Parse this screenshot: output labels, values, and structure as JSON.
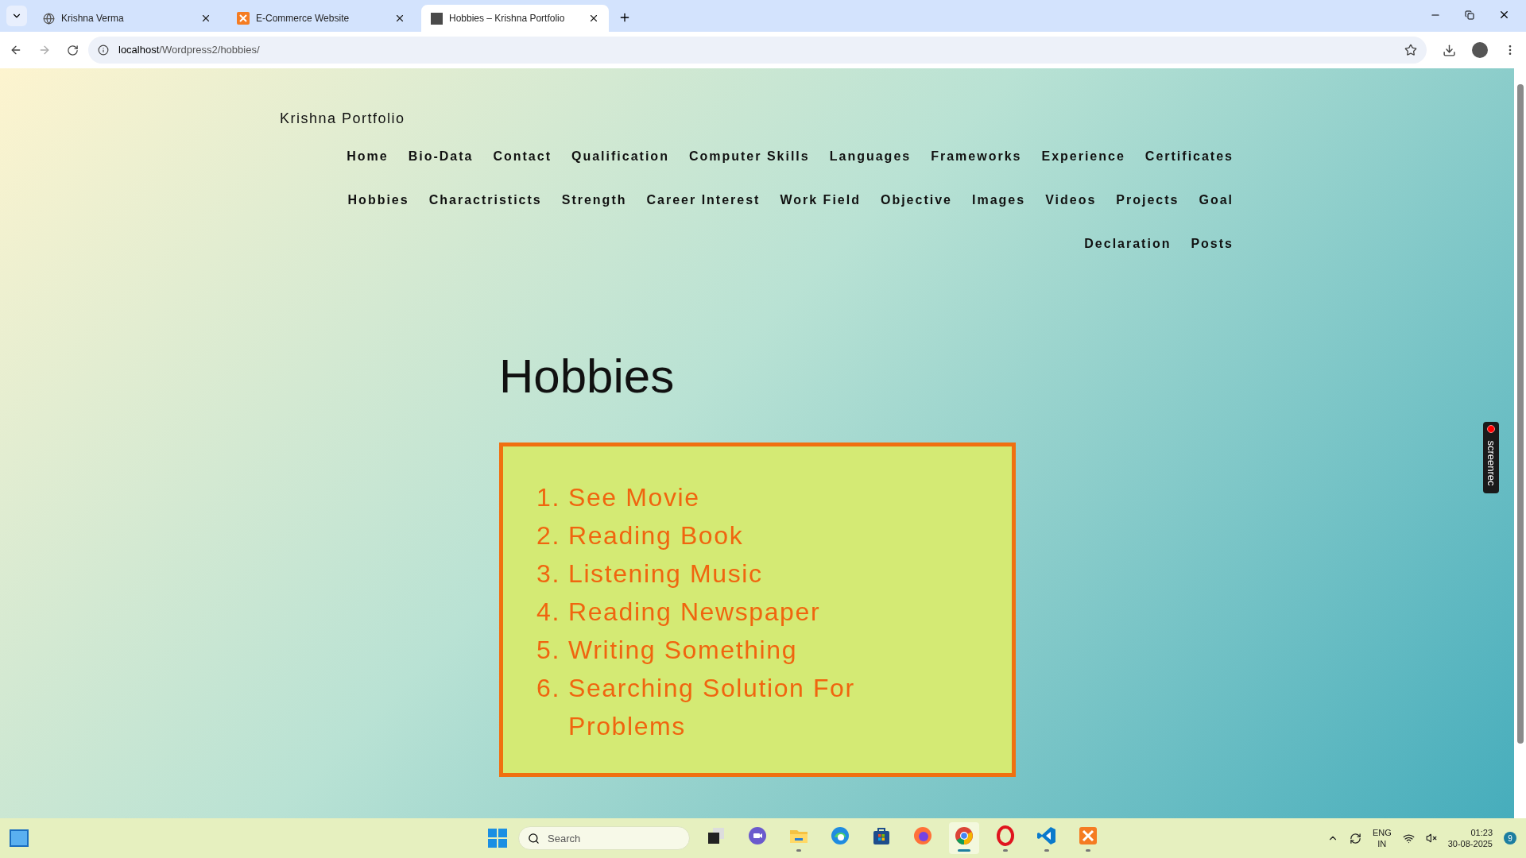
{
  "browser": {
    "tabs": [
      {
        "title": "Krishna Verma",
        "kind": "globe",
        "selected": false
      },
      {
        "title": "E-Commerce Website",
        "kind": "xampp",
        "selected": false
      },
      {
        "title": "Hobbies – Krishna Portfolio",
        "kind": "photo",
        "selected": true
      }
    ],
    "address": {
      "host": "localhost",
      "path": "/Wordpress2/hobbies/"
    }
  },
  "site": {
    "title": "Krishna Portfolio",
    "nav_rows": [
      [
        "Home",
        "Bio-Data",
        "Contact",
        "Qualification",
        "Computer Skills",
        "Languages",
        "Frameworks",
        "Experience",
        "Certificates"
      ],
      [
        "Hobbies",
        "Charactristicts",
        "Strength",
        "Career Interest",
        "Work Field",
        "Objective",
        "Images",
        "Videos",
        "Projects",
        "Goal"
      ],
      [
        "Declaration",
        "Posts"
      ]
    ]
  },
  "page": {
    "heading": "Hobbies",
    "hobbies": [
      {
        "number": "1.",
        "text": "See Movie"
      },
      {
        "number": "2.",
        "text": "Reading Book"
      },
      {
        "number": "3.",
        "text": "Listening Music"
      },
      {
        "number": "4.",
        "text": "Reading Newspaper"
      },
      {
        "number": "5.",
        "text": "Writing Something"
      },
      {
        "number": "6.",
        "text": "Searching Solution For Problems"
      }
    ]
  },
  "recorder": {
    "label": "screenrec"
  },
  "taskbar": {
    "search": {
      "placeholder": "Search"
    },
    "apps": [
      {
        "kind": "taskview",
        "running": false,
        "active": false
      },
      {
        "kind": "chat",
        "running": false,
        "active": false
      },
      {
        "kind": "files",
        "running": true,
        "active": false
      },
      {
        "kind": "edge",
        "running": false,
        "active": false
      },
      {
        "kind": "store",
        "running": false,
        "active": false
      },
      {
        "kind": "firefox",
        "running": false,
        "active": false
      },
      {
        "kind": "chrome",
        "running": true,
        "active": true
      },
      {
        "kind": "opera",
        "running": true,
        "active": false
      },
      {
        "kind": "vscode",
        "running": true,
        "active": false
      },
      {
        "kind": "xampp",
        "running": true,
        "active": false
      }
    ],
    "language": [
      "ENG",
      "IN"
    ],
    "time": "01:23",
    "date": "30-08-2025",
    "notifications": "9"
  }
}
